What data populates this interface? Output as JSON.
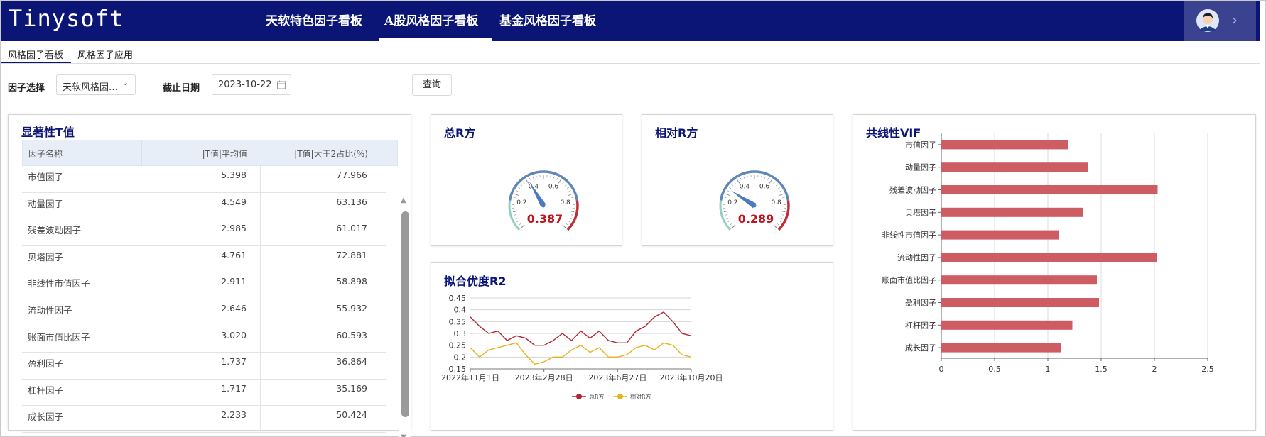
{
  "header": {
    "logo": "Tinysoft",
    "nav": [
      "天软特色因子看板",
      "A股风格因子看板",
      "基金风格因子看板"
    ],
    "active_nav": 1
  },
  "subtabs": [
    "风格因子看板",
    "风格因子应用"
  ],
  "filters": {
    "factor_label": "因子选择",
    "factor_value": "天软风格因…",
    "date_label": "截止日期",
    "date_value": "2023-10-22",
    "query_button": "查询"
  },
  "tvalue": {
    "title": "显著性T值",
    "columns": [
      "因子名称",
      "|T值|平均值",
      "|T值|大于2占比(%)"
    ],
    "rows": [
      [
        "市值因子",
        "5.398",
        "77.966"
      ],
      [
        "动量因子",
        "4.549",
        "63.136"
      ],
      [
        "残差波动因子",
        "2.985",
        "61.017"
      ],
      [
        "贝塔因子",
        "4.761",
        "72.881"
      ],
      [
        "非线性市值因子",
        "2.911",
        "58.898"
      ],
      [
        "流动性因子",
        "2.646",
        "55.932"
      ],
      [
        "账面市值比因子",
        "3.020",
        "60.593"
      ],
      [
        "盈利因子",
        "1.737",
        "36.864"
      ],
      [
        "杠杆因子",
        "1.717",
        "35.169"
      ],
      [
        "成长因子",
        "2.233",
        "50.424"
      ]
    ]
  },
  "gauge_total": {
    "title": "总R方",
    "value": 0.387,
    "value_text": "0.387",
    "ticks": [
      "0.2",
      "0.4",
      "0.6",
      "0.8"
    ]
  },
  "gauge_relative": {
    "title": "相对R方",
    "value": 0.289,
    "value_text": "0.289",
    "ticks": [
      "0.2",
      "0.4",
      "0.6",
      "0.8"
    ]
  },
  "r2": {
    "title": "拟合优度R2",
    "legend": [
      "总R方",
      "相对R方"
    ]
  },
  "vif": {
    "title": "共线性VIF"
  },
  "colors": {
    "navy": "#0b1576",
    "red_line": "#b22633",
    "yellow_line": "#e6b31a",
    "vif_bar": "#cd5c63",
    "gauge_blue": "#4a7bbf",
    "gauge_value": "#c0141e"
  },
  "chart_data": [
    {
      "type": "line",
      "title": "拟合优度R2",
      "x_ticks": [
        "2022年11月1日",
        "2023年2月28日",
        "2023年6月27日",
        "2023年10月20日"
      ],
      "x": [
        "2022-11-01",
        "2022-11-15",
        "2022-12-01",
        "2022-12-15",
        "2023-01-01",
        "2023-01-15",
        "2023-02-01",
        "2023-02-15",
        "2023-02-28",
        "2023-03-15",
        "2023-04-01",
        "2023-04-15",
        "2023-05-01",
        "2023-05-15",
        "2023-06-01",
        "2023-06-15",
        "2023-06-27",
        "2023-07-15",
        "2023-08-01",
        "2023-08-15",
        "2023-09-01",
        "2023-09-15",
        "2023-10-01",
        "2023-10-10",
        "2023-10-20"
      ],
      "series": [
        {
          "name": "总R方",
          "values": [
            0.37,
            0.33,
            0.3,
            0.31,
            0.27,
            0.29,
            0.28,
            0.25,
            0.25,
            0.27,
            0.3,
            0.27,
            0.31,
            0.28,
            0.31,
            0.27,
            0.26,
            0.26,
            0.31,
            0.33,
            0.37,
            0.39,
            0.35,
            0.3,
            0.29
          ]
        },
        {
          "name": "相对R方",
          "values": [
            0.24,
            0.2,
            0.23,
            0.24,
            0.25,
            0.26,
            0.21,
            0.17,
            0.18,
            0.2,
            0.2,
            0.23,
            0.25,
            0.22,
            0.24,
            0.2,
            0.2,
            0.21,
            0.24,
            0.25,
            0.23,
            0.26,
            0.25,
            0.21,
            0.2
          ]
        }
      ],
      "yticks": [
        0.15,
        0.2,
        0.25,
        0.3,
        0.35,
        0.4,
        0.45
      ],
      "ylim": [
        0.15,
        0.45
      ],
      "grid": true,
      "legend": "bottom"
    },
    {
      "type": "bar",
      "orientation": "horizontal",
      "title": "共线性VIF",
      "categories": [
        "市值因子",
        "动量因子",
        "残差波动因子",
        "贝塔因子",
        "非线性市值因子",
        "流动性因子",
        "账面市值比因子",
        "盈利因子",
        "杠杆因子",
        "成长因子"
      ],
      "values": [
        1.19,
        1.38,
        2.03,
        1.33,
        1.1,
        2.02,
        1.46,
        1.48,
        1.23,
        1.12
      ],
      "xticks": [
        0,
        0.5,
        1,
        1.5,
        2,
        2.5
      ],
      "xlim": [
        0,
        2.5
      ],
      "grid": true
    }
  ]
}
